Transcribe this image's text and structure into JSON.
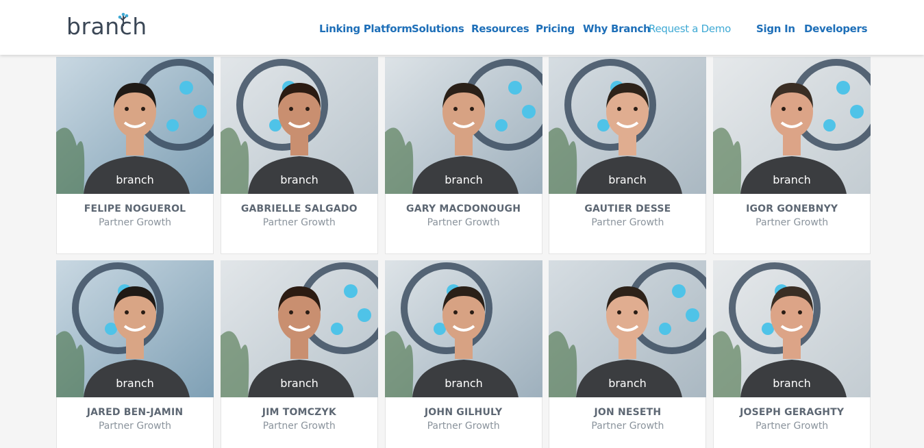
{
  "header": {
    "logo_text": "branch",
    "nav": [
      {
        "label": "Linking Platform",
        "name": "nav-linking-platform"
      },
      {
        "label": "Solutions",
        "name": "nav-solutions"
      },
      {
        "label": "Resources",
        "name": "nav-resources"
      },
      {
        "label": "Pricing",
        "name": "nav-pricing"
      },
      {
        "label": "Why Branch",
        "name": "nav-why-branch"
      },
      {
        "label": "Request a Demo",
        "name": "nav-request-demo"
      },
      {
        "label": "Sign In",
        "name": "nav-sign-in"
      },
      {
        "label": "Developers",
        "name": "nav-developers"
      }
    ]
  },
  "team": [
    {
      "name": "FELIPE NOGUEROL",
      "role": "Partner Growth",
      "shirt_text": "branch"
    },
    {
      "name": "GABRIELLE SALGADO",
      "role": "Partner Growth",
      "shirt_text": "branch"
    },
    {
      "name": "GARY MACDONOUGH",
      "role": "Partner Growth",
      "shirt_text": "branch"
    },
    {
      "name": "GAUTIER DESSE",
      "role": "Partner Growth",
      "shirt_text": "branch"
    },
    {
      "name": "IGOR GONEBNYY",
      "role": "Partner Growth",
      "shirt_text": "branch"
    },
    {
      "name": "JARED BEN-JAMIN",
      "role": "Partner Growth",
      "shirt_text": "branch"
    },
    {
      "name": "JIM TOMCZYK",
      "role": "Partner Growth",
      "shirt_text": "branch"
    },
    {
      "name": "JOHN GILHULY",
      "role": "Partner Growth",
      "shirt_text": "branch"
    },
    {
      "name": "JON NESETH",
      "role": "Partner Growth",
      "shirt_text": "branch"
    },
    {
      "name": "JOSEPH GERAGHTY",
      "role": "Partner Growth",
      "shirt_text": "branch"
    }
  ],
  "colors": {
    "brand_text": "#3b4756",
    "brand_accent": "#3ea9d4",
    "nav_link": "#1e6fb8",
    "page_background": "#f5f5f5"
  }
}
